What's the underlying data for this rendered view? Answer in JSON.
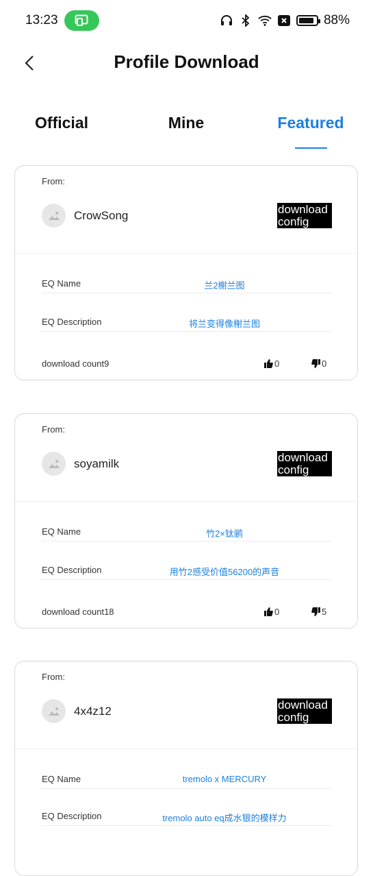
{
  "status_bar": {
    "time": "13:23",
    "battery_percent": "88%",
    "battery_level": 0.88
  },
  "header": {
    "title": "Profile Download"
  },
  "tabs": [
    {
      "label": "Official",
      "active": false
    },
    {
      "label": "Mine",
      "active": false
    },
    {
      "label": "Featured",
      "active": true
    }
  ],
  "cards": [
    {
      "from_label": "From:",
      "username": "CrowSong",
      "download_label": "download config",
      "eq_name_label": "EQ Name",
      "eq_name": "兰2榭兰图",
      "eq_desc_label": "EQ Description",
      "eq_desc": "将兰变得像榭兰图",
      "download_count": "download count9",
      "likes": "0",
      "dislikes": "0"
    },
    {
      "from_label": "From:",
      "username": "soyamilk",
      "download_label": "download config",
      "eq_name_label": "EQ Name",
      "eq_name": "竹2×钛鹂",
      "eq_desc_label": "EQ Description",
      "eq_desc": "用竹2感受价值56200的声音",
      "download_count": "download count18",
      "likes": "0",
      "dislikes": "5"
    },
    {
      "from_label": "From:",
      "username": "4x4z12",
      "download_label": "download config",
      "eq_name_label": "EQ Name",
      "eq_name": "tremolo x MERCURY",
      "eq_desc_label": "EQ Description",
      "eq_desc": "tremolo auto eq成水银的模样力",
      "download_count": "",
      "likes": "",
      "dislikes": ""
    }
  ],
  "colors": {
    "accent": "#1c7fe0",
    "cast_green": "#35c759",
    "button_bg": "#000000"
  },
  "icons": [
    "back-arrow-icon",
    "screen-cast-icon",
    "headphones-icon",
    "bluetooth-icon",
    "wifi-icon",
    "notification-x-icon",
    "battery-icon",
    "avatar-placeholder-icon",
    "thumbs-up-icon",
    "thumbs-down-icon"
  ]
}
